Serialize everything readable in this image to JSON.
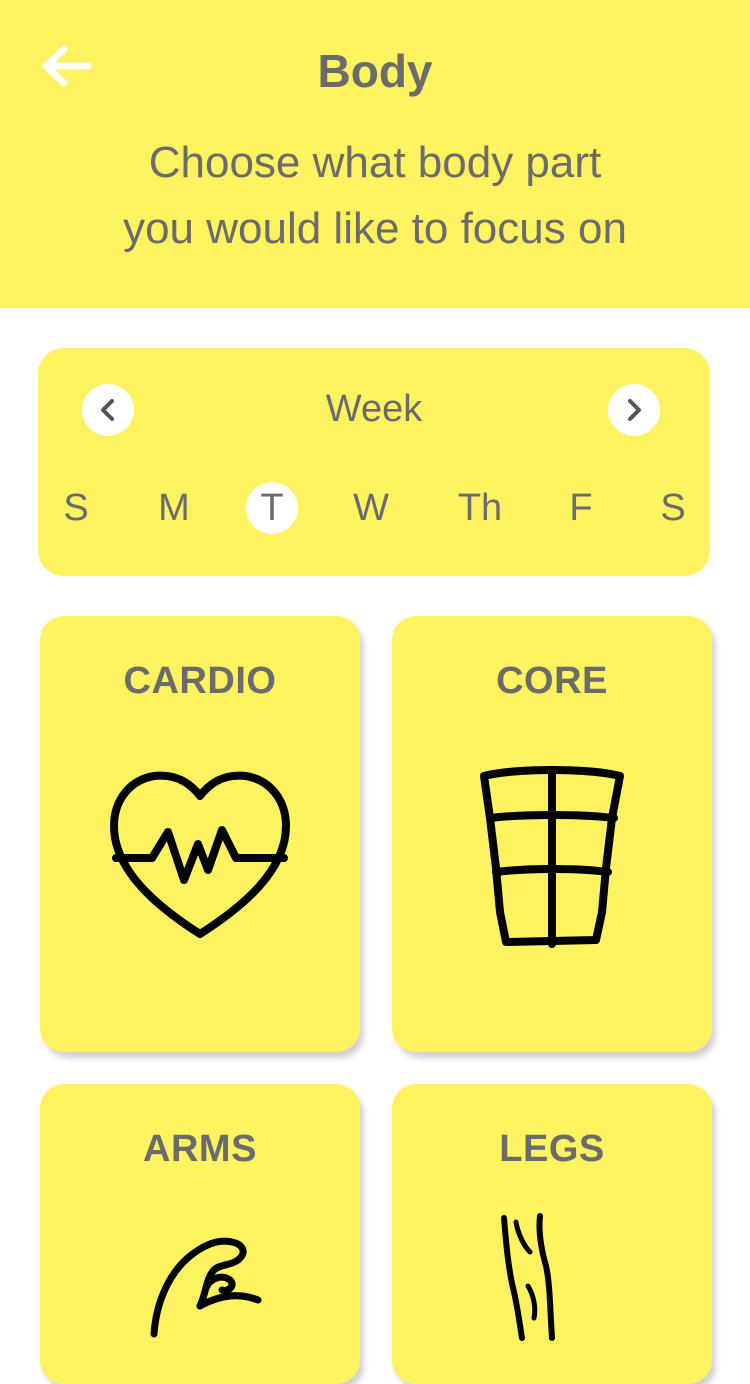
{
  "header": {
    "title": "Body",
    "subtitle_line1": "Choose what body part",
    "subtitle_line2": "you would like to focus on",
    "background_color": "#fdf25f"
  },
  "week": {
    "label": "Week",
    "days": [
      "S",
      "M",
      "T",
      "W",
      "Th",
      "F",
      "S"
    ],
    "selected_day": "T"
  },
  "categories": [
    {
      "label": "CARDIO",
      "icon": "heart-pulse-icon"
    },
    {
      "label": "CORE",
      "icon": "abs-icon"
    },
    {
      "label": "ARMS",
      "icon": "flexed-bicep-icon"
    },
    {
      "label": "LEGS",
      "icon": "leg-icon"
    }
  ],
  "colors": {
    "accent": "#fdf25f",
    "text": "#6b6b6b",
    "icon": "#000000"
  }
}
